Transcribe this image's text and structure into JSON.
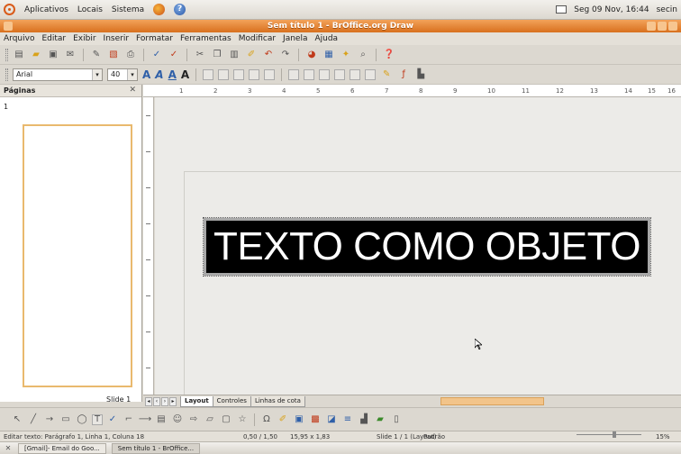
{
  "panel": {
    "menus": [
      "Aplicativos",
      "Locais",
      "Sistema"
    ],
    "clock": "Seg 09 Nov, 16:44",
    "user": "secin"
  },
  "window": {
    "title": "Sem título 1 - BrOffice.org Draw"
  },
  "menubar": [
    "Arquivo",
    "Editar",
    "Exibir",
    "Inserir",
    "Formatar",
    "Ferramentas",
    "Modificar",
    "Janela",
    "Ajuda"
  ],
  "format": {
    "font_name": "Arial",
    "font_size": "40"
  },
  "pages_pane": {
    "title": "Páginas",
    "slide_number": "1",
    "slide_label": "Slide 1"
  },
  "ruler_h": [
    "1",
    "2",
    "3",
    "4",
    "5",
    "6",
    "7",
    "8",
    "9",
    "10",
    "11",
    "12",
    "13",
    "14",
    "15",
    "16"
  ],
  "canvas": {
    "text_object": "TEXTO COMO OBJETO"
  },
  "tabs": [
    "Layout",
    "Controles",
    "Linhas de cota"
  ],
  "status": {
    "edit": "Editar texto: Parágrafo 1, Linha 1, Coluna 18",
    "position": "0,50 / 1,50",
    "size": "15,95 x 1,83",
    "slide": "Slide 1 / 1 (Layout)",
    "style": "Padrão",
    "zoom": "15%"
  },
  "taskbar": {
    "items": [
      "[Gmail]- Email do Goo...",
      "Sem título 1 - BrOffice..."
    ]
  }
}
